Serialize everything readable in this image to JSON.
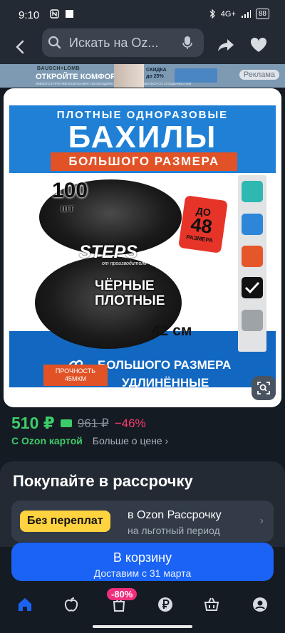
{
  "status_bar": {
    "time": "9:10",
    "network": "4G+",
    "battery": "88"
  },
  "search": {
    "placeholder": "Искать на Oz..."
  },
  "ad": {
    "brand": "BAUSCH+LOMB",
    "headline": "ОТКРОЙТЕ КОМФОРТ",
    "disclaimer": "ИМЕЮТСЯ ПРОТИВОПОКАЗАНИЯ. НЕОБХОДИМО ПРОКОНСУЛЬТИРОВАТЬСЯ СО СПЕЦИАЛИСТОМ",
    "sale_line1": "СКИДКА",
    "sale_line2": "до 25%",
    "label": "Реклама"
  },
  "product_image": {
    "line1": "ПЛОТНЫЕ ОДНОРАЗОВЫЕ",
    "line2": "БАХИЛЫ",
    "line3": "БОЛЬШОГО РАЗМЕРА",
    "count": "100",
    "count_unit": "шт",
    "tag_top": "ДО",
    "tag_number": "48",
    "tag_bottom": "РАЗМЕРА",
    "brand": "STEPS",
    "brand_sub": "от производителя",
    "black_line1": "ЧЁРНЫЕ",
    "black_line2": "ПЛОТНЫЕ",
    "size": "42 см",
    "bottom_line1": "БОЛЬШОГО РАЗМЕРА",
    "bottom_line2": "УДЛИНЁННЫЕ",
    "strength_line1": "ПРОЧНОСТЬ",
    "strength_line2": "45МКМ"
  },
  "price": {
    "current": "510 ₽",
    "old": "961 ₽",
    "discount": "−46%",
    "card_label": "С Ozon картой",
    "more_link": "Больше о цене"
  },
  "installment": {
    "title": "Покупайте в рассрочку",
    "chip": "Без переплат",
    "line1": "в Ozon Рассрочку",
    "line2": "на льготный период"
  },
  "cart": {
    "label": "В корзину",
    "delivery": "Доставим с 31 марта"
  },
  "nav": {
    "badge": "-80%"
  },
  "colors": {
    "accent_blue": "#1a63f5",
    "price_green": "#3dcc6a",
    "discount_pink": "#f63b6c",
    "chip_yellow": "#ffd23f"
  }
}
